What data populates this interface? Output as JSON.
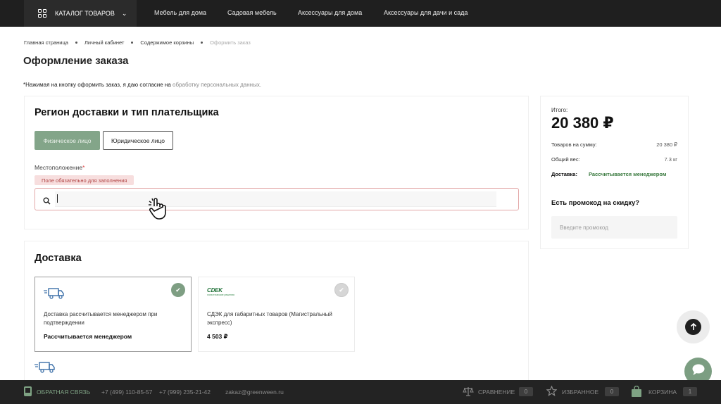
{
  "nav": {
    "catalog_label": "КАТАЛОГ ТОВАРОВ",
    "links": [
      "Мебель для дома",
      "Садовая мебель",
      "Аксессуары для дома",
      "Аксессуары для дачи и сада"
    ]
  },
  "breadcrumb": [
    "Главная страница",
    "Личный кабинет",
    "Содержимое корзины",
    "Оформить заказ"
  ],
  "page_title": "Оформление заказа",
  "consent": {
    "text": "*Нажимая на кнопку оформить заказ, я даю согласие на ",
    "link": "обработку персональных данных."
  },
  "region": {
    "title": "Регион доставки и тип плательщика",
    "payer_types": [
      "Физическое лицо",
      "Юридическое лицо"
    ],
    "selected_payer": "Физическое лицо",
    "location_label": "Местоположение",
    "required_mark": "*",
    "error": "Поле обязательно для заполнения",
    "location_value": ""
  },
  "delivery": {
    "title": "Доставка",
    "options": [
      {
        "desc": "Доставка рассчитывается менеджером при подтверждении",
        "price": "Рассчитывается менеджером",
        "selected": true,
        "icon": "truck-icon"
      },
      {
        "desc": "СДЭК для габаритных товаров (Магистральный экспресс)",
        "price": "4 503 ₽",
        "selected": false,
        "icon": "cdek-logo",
        "logo_text": "CDEK",
        "logo_sub": "логистические решения"
      }
    ]
  },
  "summary": {
    "total_label": "Итого:",
    "total": "20 380 ₽",
    "goods_label": "Товаров на сумму:",
    "goods_value": "20 380 ₽",
    "weight_label": "Общий вес:",
    "weight_value": "7.3 кг",
    "delivery_label": "Доставка:",
    "delivery_value": "Рассчитывается менеджером",
    "promo_title": "Есть промокод на скидку?",
    "promo_placeholder": "Введите промокод"
  },
  "bottom": {
    "feedback": "ОБРАТНАЯ СВЯЗЬ",
    "phone1": "+7 (499) 110-85-57",
    "phone2": "+7 (999) 235-21-42",
    "email": "zakaz@greenween.ru",
    "compare": "СРАВНЕНИЕ",
    "compare_count": "0",
    "favorites": "ИЗБРАННОЕ",
    "favorites_count": "0",
    "cart": "КОРЗИНА",
    "cart_count": "1"
  },
  "colors": {
    "accent": "#83a589",
    "dark": "#1f1f1f",
    "error_bg": "#f7dede",
    "green_text": "#3a7a3f"
  }
}
